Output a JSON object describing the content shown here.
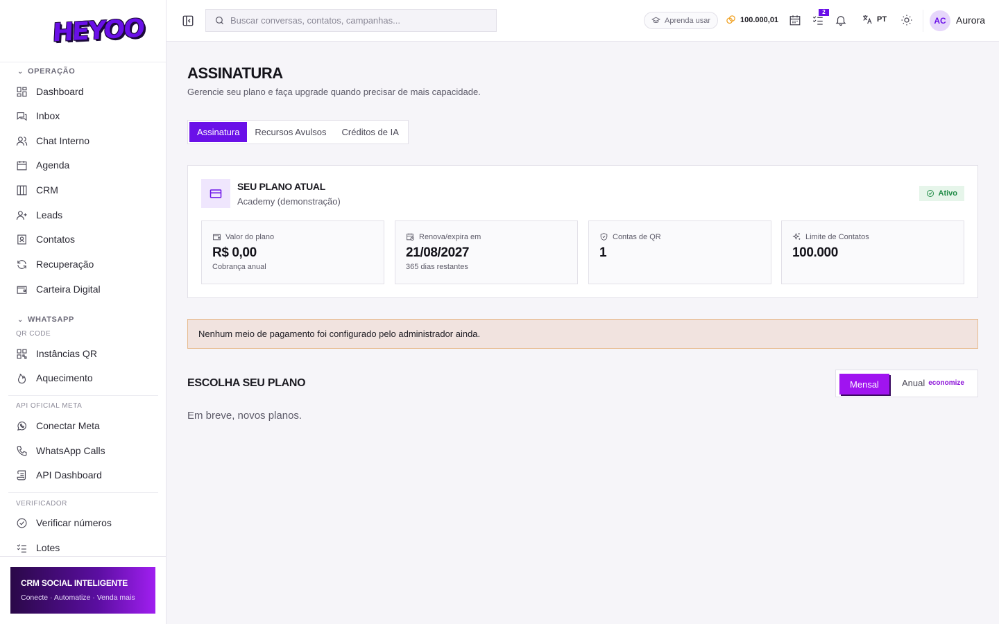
{
  "brand": {
    "logo_text": "HEYOO"
  },
  "sidebar": {
    "sections": [
      {
        "title": "OPERAÇÃO"
      },
      {
        "title": "WHATSAPP",
        "subtitle": "QR CODE"
      },
      {
        "subtitle": "API OFICIAL META"
      },
      {
        "subtitle": "VERIFICADOR"
      }
    ],
    "items": [
      {
        "label": "Dashboard",
        "icon": "dashboard-icon"
      },
      {
        "label": "Inbox",
        "icon": "inbox-icon"
      },
      {
        "label": "Chat Interno",
        "icon": "users-icon"
      },
      {
        "label": "Agenda",
        "icon": "calendar-icon"
      },
      {
        "label": "CRM",
        "icon": "kanban-icon"
      },
      {
        "label": "Leads",
        "icon": "user-plus-icon"
      },
      {
        "label": "Contatos",
        "icon": "contact-book-icon"
      },
      {
        "label": "Recuperação",
        "icon": "refresh-icon"
      },
      {
        "label": "Carteira Digital",
        "icon": "wallet-icon"
      },
      {
        "label": "Instâncias QR",
        "icon": "qr-icon"
      },
      {
        "label": "Aquecimento",
        "icon": "flame-icon"
      },
      {
        "label": "Conectar Meta",
        "icon": "whatsapp-icon"
      },
      {
        "label": "WhatsApp Calls",
        "icon": "phone-icon"
      },
      {
        "label": "API Dashboard",
        "icon": "scroll-icon"
      },
      {
        "label": "Verificar números",
        "icon": "check-circle-icon"
      },
      {
        "label": "Lotes",
        "icon": "list-check-icon"
      }
    ],
    "promo": {
      "title": "CRM SOCIAL INTELIGENTE",
      "subtitle": "Conecte · Automatize · Venda mais"
    }
  },
  "topbar": {
    "search_placeholder": "Buscar conversas, contatos, campanhas...",
    "learn_label": "Aprenda usar",
    "credits": "100.000,01",
    "tasks_badge": "2",
    "language": "PT",
    "user_initials": "AC",
    "user_name": "Aurora"
  },
  "page": {
    "title": "ASSINATURA",
    "subtitle": "Gerencie seu plano e faça upgrade quando precisar de mais capacidade.",
    "tabs": [
      "Assinatura",
      "Recursos Avulsos",
      "Créditos de IA"
    ],
    "active_tab": 0
  },
  "plan": {
    "heading": "SEU PLANO ATUAL",
    "name": "Academy (demonstração)",
    "status": "Ativo",
    "stats": [
      {
        "label": "Valor do plano",
        "value": "R$ 0,00",
        "note": "Cobrança anual",
        "icon": "wallet-icon"
      },
      {
        "label": "Renova/expira em",
        "value": "21/08/2027",
        "note": "365 dias restantes",
        "icon": "calendar-clock-icon"
      },
      {
        "label": "Contas de QR",
        "value": "1",
        "note": "",
        "icon": "shield-check-icon"
      },
      {
        "label": "Limite de Contatos",
        "value": "100.000",
        "note": "",
        "icon": "sparkles-icon"
      }
    ]
  },
  "alert": {
    "message": "Nenhum meio de pagamento foi configurado pelo administrador ainda."
  },
  "choose": {
    "title": "ESCOLHA SEU PLANO",
    "toggle_monthly": "Mensal",
    "toggle_annual": "Anual",
    "toggle_annual_badge": "economize",
    "empty_message": "Em breve, novos planos."
  },
  "colors": {
    "accent": "#6a10e8",
    "accent_bright": "#a014f0",
    "success": "#1d8a44",
    "warning_border": "#e7b98c"
  }
}
